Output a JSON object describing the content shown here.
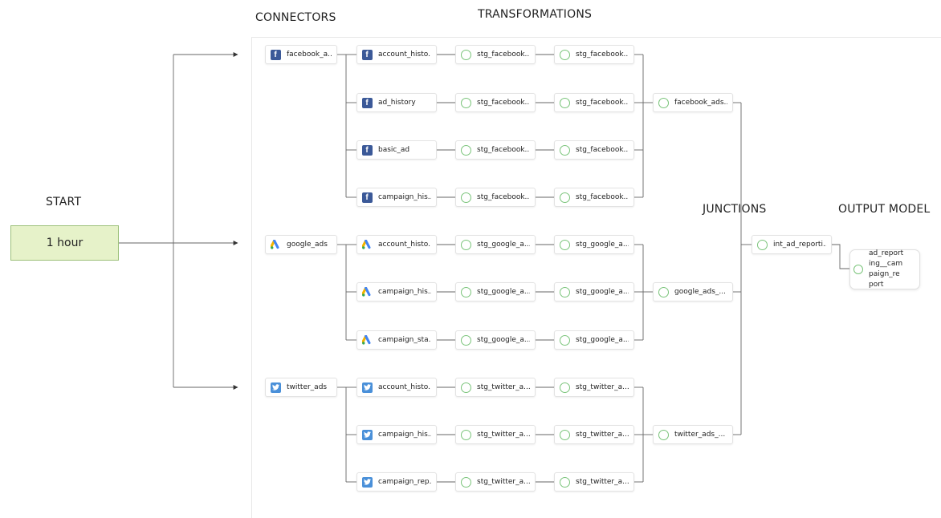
{
  "headers": {
    "connectors": "CONNECTORS",
    "transformations": "TRANSFORMATIONS",
    "start": "START",
    "junctions": "JUNCTIONS",
    "output_model": "OUTPUT MODEL"
  },
  "schedule": {
    "label": "1 hour"
  },
  "colors": {
    "start_fill": "#e6f2c9",
    "check": "#7ac47a",
    "facebook": "#3b5998",
    "twitter": "#4a90d9"
  },
  "groups": [
    {
      "connector": {
        "label": "facebook_a...",
        "icon": "facebook-icon"
      },
      "rows": [
        {
          "source": "account_histo...",
          "stg1": "stg_facebook...",
          "stg2": "stg_facebook..."
        },
        {
          "source": "ad_history",
          "stg1": "stg_facebook...",
          "stg2": "stg_facebook..."
        },
        {
          "source": "basic_ad",
          "stg1": "stg_facebook...",
          "stg2": "stg_facebook..."
        },
        {
          "source": "campaign_his...",
          "stg1": "stg_facebook...",
          "stg2": "stg_facebook..."
        }
      ],
      "aggregate": "facebook_ads..."
    },
    {
      "connector": {
        "label": "google_ads",
        "icon": "google-ads-icon"
      },
      "rows": [
        {
          "source": "account_histo...",
          "stg1": "stg_google_a...",
          "stg2": "stg_google_a..."
        },
        {
          "source": "campaign_his...",
          "stg1": "stg_google_a...",
          "stg2": "stg_google_a..."
        },
        {
          "source": "campaign_sta...",
          "stg1": "stg_google_a...",
          "stg2": "stg_google_a..."
        }
      ],
      "aggregate": "google_ads_..."
    },
    {
      "connector": {
        "label": "twitter_ads",
        "icon": "twitter-icon"
      },
      "rows": [
        {
          "source": "account_histo...",
          "stg1": "stg_twitter_a...",
          "stg2": "stg_twitter_a..."
        },
        {
          "source": "campaign_his...",
          "stg1": "stg_twitter_a...",
          "stg2": "stg_twitter_a..."
        },
        {
          "source": "campaign_rep...",
          "stg1": "stg_twitter_a...",
          "stg2": "stg_twitter_a..."
        }
      ],
      "aggregate": "twitter_ads_..."
    }
  ],
  "junction": {
    "label": "int_ad_reporti..."
  },
  "output": {
    "label": "ad_reporting__campaign_report"
  }
}
